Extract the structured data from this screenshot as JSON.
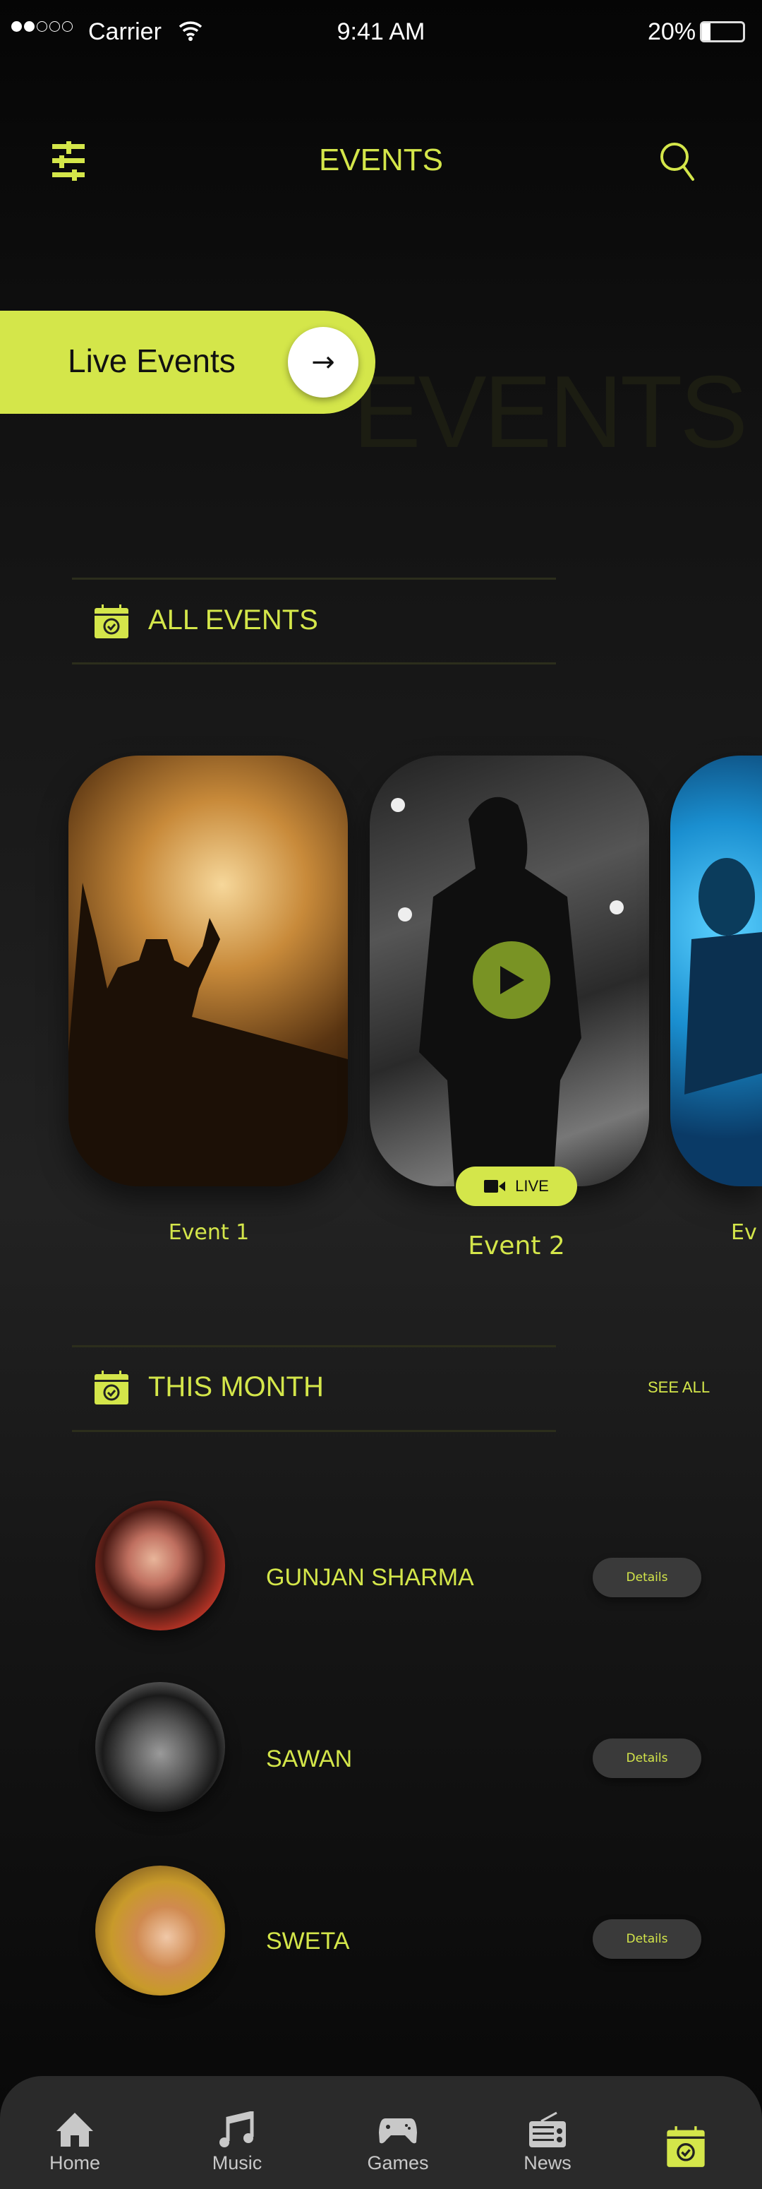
{
  "status_bar": {
    "carrier": "Carrier",
    "time": "9:41 AM",
    "battery": "20%",
    "battery_level": 0.2,
    "signal_bars": 2
  },
  "header": {
    "title": "EVENTS",
    "filter_icon": "sliders-icon",
    "search_icon": "search-icon"
  },
  "hero": {
    "button_label": "Live Events",
    "background_text": "EVENTS"
  },
  "all_events": {
    "title": "ALL EVENTS",
    "events": [
      {
        "label": "Event 1",
        "live": false
      },
      {
        "label": "Event 2",
        "live": true,
        "live_label": "LIVE"
      },
      {
        "label": "Ev",
        "live": false
      }
    ]
  },
  "this_month": {
    "title": "THIS MONTH",
    "see_all": "SEE ALL",
    "items": [
      {
        "name": "GUNJAN SHARMA",
        "button": "Details"
      },
      {
        "name": "SAWAN",
        "button": "Details"
      },
      {
        "name": "SWETA",
        "button": "Details"
      }
    ]
  },
  "nav": {
    "items": [
      {
        "label": "Home",
        "icon": "home-icon"
      },
      {
        "label": "Music",
        "icon": "music-icon"
      },
      {
        "label": "Games",
        "icon": "gamepad-icon"
      },
      {
        "label": "News",
        "icon": "radio-icon"
      },
      {
        "label": "",
        "icon": "calendar-check-icon",
        "active": true
      }
    ]
  },
  "colors": {
    "accent": "#d4e64a",
    "background": "#111111",
    "nav": "#2a2a2a",
    "button": "#3a3a3a"
  }
}
